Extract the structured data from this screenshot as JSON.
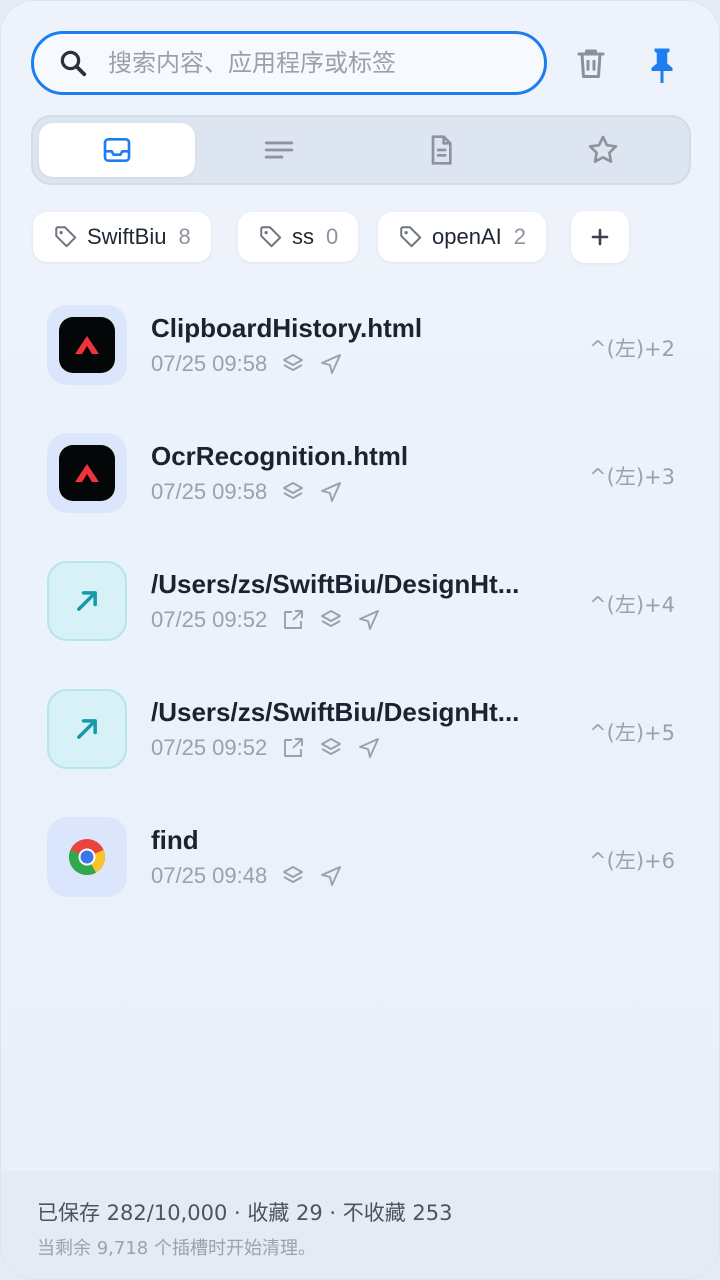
{
  "search": {
    "placeholder": "搜索内容、应用程序或标签",
    "value": ""
  },
  "toolbar": {
    "trash_icon": "trash-icon",
    "pin_icon": "pin-icon",
    "accent": "#1e7ef0"
  },
  "tabs": [
    {
      "icon": "inbox-icon",
      "active": true
    },
    {
      "icon": "text-lines-icon",
      "active": false
    },
    {
      "icon": "document-icon",
      "active": false
    },
    {
      "icon": "star-icon",
      "active": false
    }
  ],
  "tags": [
    {
      "name": "SwiftBiu",
      "count": "8"
    },
    {
      "name": "ss",
      "count": "0"
    },
    {
      "name": "openAI",
      "count": "2"
    }
  ],
  "items": [
    {
      "title": "ClipboardHistory.html",
      "time": "07/25 09:58",
      "shortcut": "^(左)+2",
      "app": "black-arrow-app-icon"
    },
    {
      "title": "OcrRecognition.html",
      "time": "07/25 09:58",
      "shortcut": "^(左)+3",
      "app": "black-arrow-app-icon"
    },
    {
      "title": "/Users/zs/SwiftBiu/DesignHt...",
      "time": "07/25 09:52",
      "shortcut": "^(左)+4",
      "app": "link-arrow-icon"
    },
    {
      "title": "/Users/zs/SwiftBiu/DesignHt...",
      "time": "07/25 09:52",
      "shortcut": "^(左)+5",
      "app": "link-arrow-icon"
    },
    {
      "title": "find",
      "time": "07/25 09:48",
      "shortcut": "^(左)+6",
      "app": "chrome-icon"
    }
  ],
  "footer": {
    "stats": "已保存 282/10,000 · 收藏 29 · 不收藏 253",
    "note": "当剩余 9,718 个插槽时开始清理。"
  }
}
